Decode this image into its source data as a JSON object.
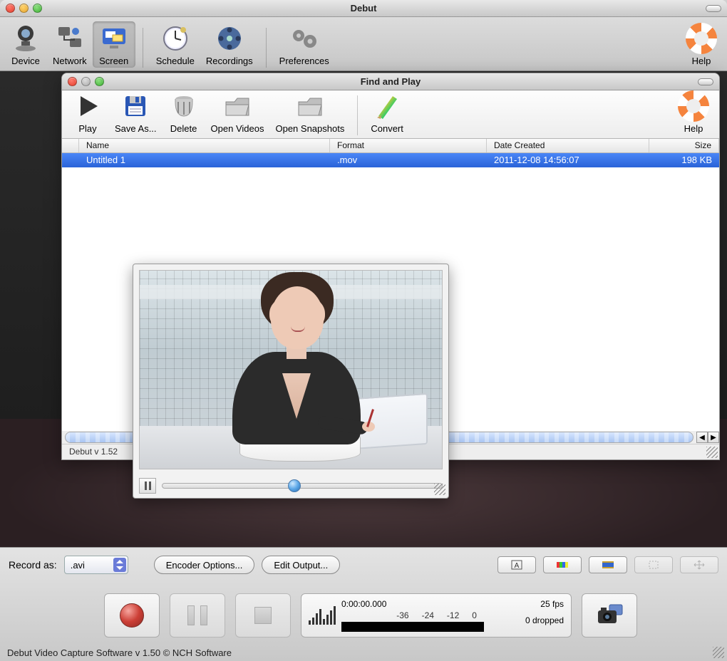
{
  "main": {
    "title": "Debut",
    "toolbar": {
      "device": "Device",
      "network": "Network",
      "screen": "Screen",
      "schedule": "Schedule",
      "recordings": "Recordings",
      "preferences": "Preferences",
      "help": "Help"
    }
  },
  "findplay": {
    "title": "Find and Play",
    "toolbar": {
      "play": "Play",
      "saveas": "Save As...",
      "delete": "Delete",
      "openvideos": "Open Videos",
      "opensnapshots": "Open Snapshots",
      "convert": "Convert",
      "help": "Help"
    },
    "columns": {
      "name": "Name",
      "format": "Format",
      "date": "Date Created",
      "size": "Size"
    },
    "row": {
      "name": "Untitled 1",
      "format": ".mov",
      "date": "2011-12-08 14:56:07",
      "size": "198 KB"
    },
    "status": "Debut v 1.52"
  },
  "bottom": {
    "recordas_label": "Record as:",
    "format_value": ".avi",
    "encoder_btn": "Encoder Options...",
    "editoutput_btn": "Edit Output...",
    "timecode": "0:00:00.000",
    "db": {
      "a": "-36",
      "b": "-24",
      "c": "-12",
      "d": "0"
    },
    "fps": "25 fps",
    "dropped": "0 dropped"
  },
  "footer": "Debut Video Capture Software v 1.50 © NCH Software"
}
